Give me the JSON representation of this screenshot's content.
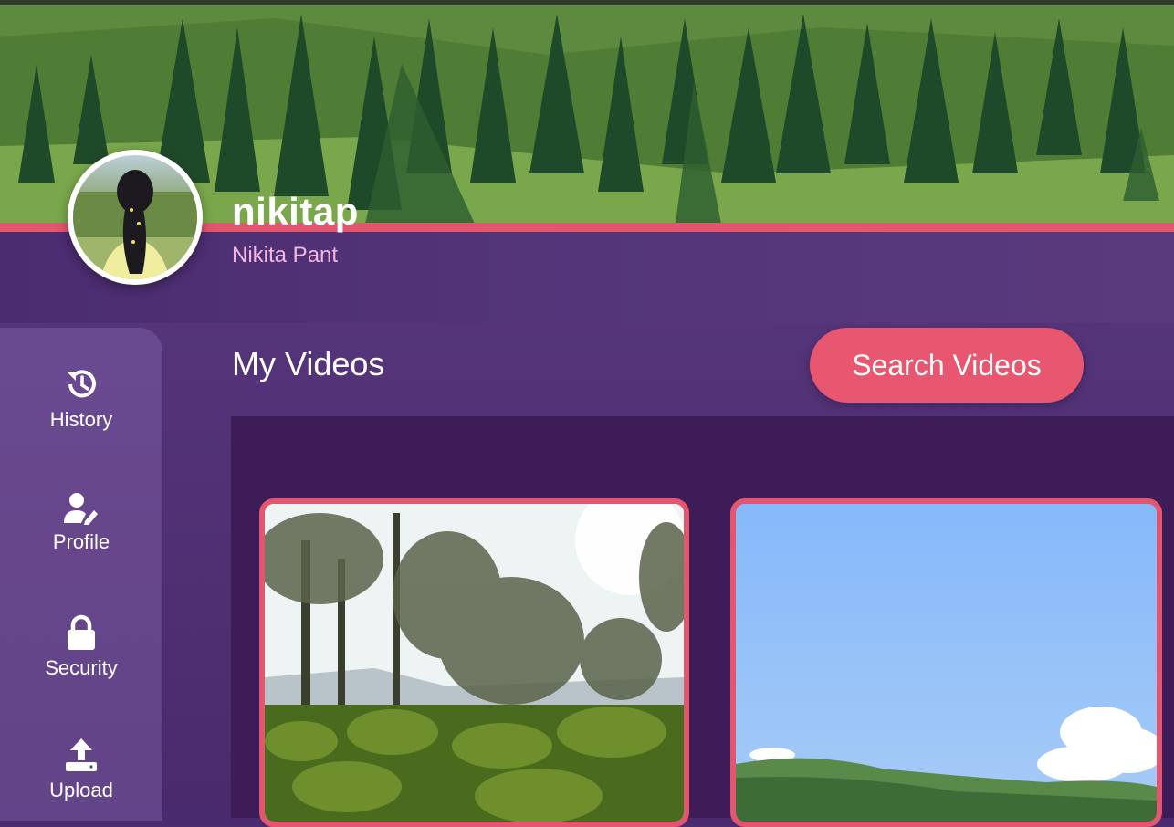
{
  "profile": {
    "username": "nikitap",
    "full_name": "Nikita Pant"
  },
  "sidebar": {
    "items": [
      {
        "label": "History",
        "icon": "history-icon"
      },
      {
        "label": "Profile",
        "icon": "user-edit-icon"
      },
      {
        "label": "Security",
        "icon": "lock-icon"
      },
      {
        "label": "Upload",
        "icon": "upload-icon"
      }
    ]
  },
  "main": {
    "title": "My Videos",
    "search_button": "Search Videos"
  },
  "colors": {
    "accent": "#e8566f",
    "background": "#4f2f73",
    "panel": "#3d1c58"
  }
}
